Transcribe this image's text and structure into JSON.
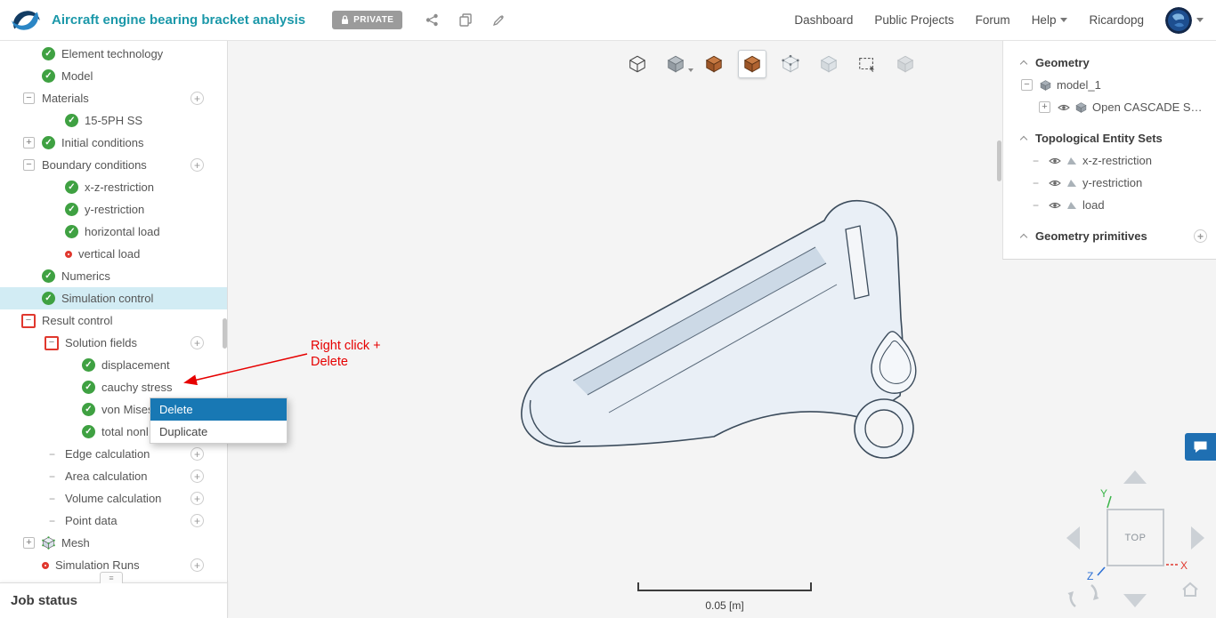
{
  "colors": {
    "accent_teal": "#1b98a9",
    "selected_row": "#d2ecf4",
    "menu_highlight": "#1878b4",
    "annotation_red": "#e60000",
    "check_green": "#3fa142",
    "error_red": "#e0382e",
    "chat_blue": "#1f6fb2",
    "private_badge_gray": "#9b9b9b",
    "tool_orange": "#b65c2e"
  },
  "header": {
    "title": "Aircraft engine bearing bracket analysis",
    "private_label": "PRIVATE",
    "nav": {
      "dashboard": "Dashboard",
      "public_projects": "Public Projects",
      "forum": "Forum",
      "help": "Help",
      "username": "Ricardopg"
    }
  },
  "sidebar": {
    "items": [
      {
        "label": "Element technology"
      },
      {
        "label": "Model"
      },
      {
        "label": "Materials"
      },
      {
        "label": "15-5PH SS"
      },
      {
        "label": "Initial conditions"
      },
      {
        "label": "Boundary conditions"
      },
      {
        "label": "x-z-restriction"
      },
      {
        "label": "y-restriction"
      },
      {
        "label": "horizontal load"
      },
      {
        "label": "vertical load"
      },
      {
        "label": "Numerics"
      },
      {
        "label": "Simulation control"
      },
      {
        "label": "Result control"
      },
      {
        "label": "Solution fields"
      },
      {
        "label": "displacement"
      },
      {
        "label": "cauchy stress"
      },
      {
        "label": "von Mises"
      },
      {
        "label": "total nonl"
      },
      {
        "label": "Edge calculation"
      },
      {
        "label": "Area calculation"
      },
      {
        "label": "Volume calculation"
      },
      {
        "label": "Point data"
      },
      {
        "label": "Mesh"
      },
      {
        "label": "Simulation Runs"
      }
    ],
    "job_status": "Job status"
  },
  "context_menu": {
    "delete": "Delete",
    "duplicate": "Duplicate"
  },
  "annotation": {
    "line1": "Right click +",
    "line2": "Delete"
  },
  "viewport": {
    "scale_label": "0.05 [m]"
  },
  "right_panel": {
    "geometry_title": "Geometry",
    "model_name": "model_1",
    "cad_name": "Open CASCADE STE...",
    "topo_title": "Topological Entity Sets",
    "topo_items": [
      {
        "label": "x-z-restriction"
      },
      {
        "label": "y-restriction"
      },
      {
        "label": "load"
      }
    ],
    "primitives_title": "Geometry primitives"
  },
  "nav_cube": {
    "face": "TOP",
    "x": "X",
    "y": "Y",
    "z": "Z"
  }
}
